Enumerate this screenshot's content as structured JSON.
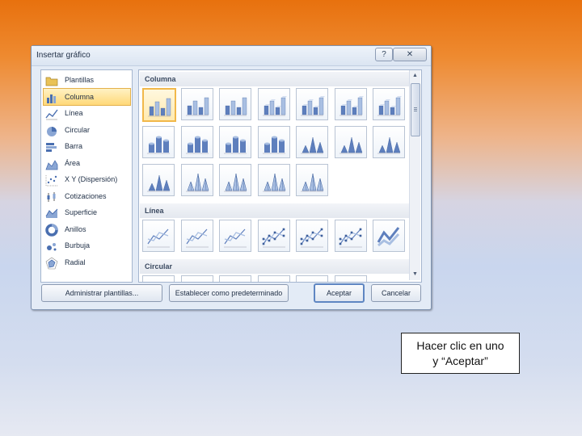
{
  "dialog": {
    "title": "Insertar gráfico",
    "help_label": "?",
    "close_label": "✕",
    "categories": [
      {
        "label": "Plantillas",
        "icon": "folder-icon",
        "selected": false
      },
      {
        "label": "Columna",
        "icon": "column-chart-icon",
        "selected": true
      },
      {
        "label": "Línea",
        "icon": "line-chart-icon",
        "selected": false
      },
      {
        "label": "Circular",
        "icon": "pie-chart-icon",
        "selected": false
      },
      {
        "label": "Barra",
        "icon": "bar-chart-icon",
        "selected": false
      },
      {
        "label": "Área",
        "icon": "area-chart-icon",
        "selected": false
      },
      {
        "label": "X Y (Dispersión)",
        "icon": "scatter-chart-icon",
        "selected": false
      },
      {
        "label": "Cotizaciones",
        "icon": "stock-chart-icon",
        "selected": false
      },
      {
        "label": "Superficie",
        "icon": "surface-chart-icon",
        "selected": false
      },
      {
        "label": "Anillos",
        "icon": "doughnut-chart-icon",
        "selected": false
      },
      {
        "label": "Burbuja",
        "icon": "bubble-chart-icon",
        "selected": false
      },
      {
        "label": "Radial",
        "icon": "radar-chart-icon",
        "selected": false
      }
    ],
    "sections": [
      {
        "title": "Columna",
        "rows": [
          [
            "clustered-column",
            "stacked-column",
            "100-stacked-column",
            "3d-clustered-column",
            "3d-stacked-column",
            "3d-100-stacked-column",
            "3d-column"
          ],
          [
            "clustered-cylinder",
            "stacked-cylinder",
            "100-stacked-cylinder",
            "3d-cylinder",
            "clustered-cone",
            "stacked-cone",
            "100-stacked-cone"
          ],
          [
            "3d-cone",
            "clustered-pyramid",
            "stacked-pyramid",
            "100-stacked-pyramid",
            "3d-pyramid"
          ]
        ]
      },
      {
        "title": "Línea",
        "rows": [
          [
            "line",
            "stacked-line",
            "100-stacked-line",
            "line-markers",
            "stacked-line-markers",
            "100-stacked-line-markers",
            "3d-line"
          ]
        ]
      },
      {
        "title": "Circular",
        "rows": [
          [
            "pie",
            "3d-pie",
            "pie-of-pie",
            "exploded-pie",
            "3d-exploded-pie",
            "bar-of-pie"
          ]
        ]
      }
    ],
    "buttons": {
      "manage_templates": "Administrar plantillas...",
      "set_default": "Establecer como predeterminado",
      "accept": "Aceptar",
      "cancel": "Cancelar"
    },
    "colors": {
      "accent": "#4a6fb0",
      "selection": "#ffd878"
    }
  },
  "note": {
    "line1": "Hacer clic en uno",
    "line2": "y “Aceptar”"
  }
}
